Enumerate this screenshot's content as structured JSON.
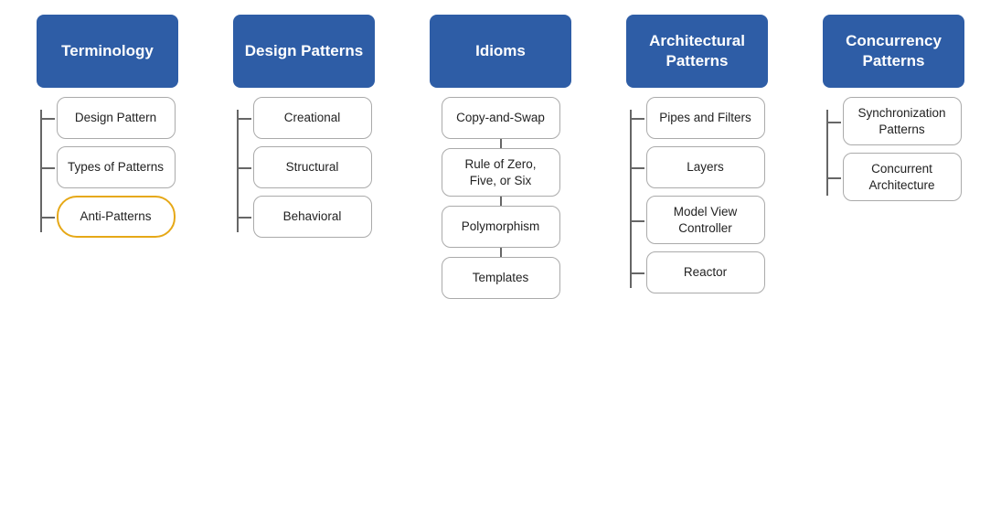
{
  "columns": [
    {
      "id": "terminology",
      "header": "Terminology",
      "treeType": "left",
      "items": [
        {
          "label": "Design Pattern",
          "highlighted": false
        },
        {
          "label": "Types of Patterns",
          "highlighted": false
        },
        {
          "label": "Anti-Patterns",
          "highlighted": true
        }
      ]
    },
    {
      "id": "design-patterns",
      "header": "Design Patterns",
      "treeType": "left",
      "items": [
        {
          "label": "Creational",
          "highlighted": false
        },
        {
          "label": "Structural",
          "highlighted": false
        },
        {
          "label": "Behavioral",
          "highlighted": false
        }
      ]
    },
    {
      "id": "idioms",
      "header": "Idioms",
      "treeType": "center",
      "items": [
        {
          "label": "Copy-and-Swap",
          "highlighted": false
        },
        {
          "label": "Rule of Zero, Five, or Six",
          "highlighted": false
        },
        {
          "label": "Polymorphism",
          "highlighted": false
        },
        {
          "label": "Templates",
          "highlighted": false
        }
      ]
    },
    {
      "id": "architectural-patterns",
      "header": "Architectural Patterns",
      "treeType": "left",
      "items": [
        {
          "label": "Pipes and Filters",
          "highlighted": false
        },
        {
          "label": "Layers",
          "highlighted": false
        },
        {
          "label": "Model View Controller",
          "highlighted": false
        },
        {
          "label": "Reactor",
          "highlighted": false
        }
      ]
    },
    {
      "id": "concurrency-patterns",
      "header": "Concurrency Patterns",
      "treeType": "left",
      "items": [
        {
          "label": "Synchronization Patterns",
          "highlighted": false
        },
        {
          "label": "Concurrent Architecture",
          "highlighted": false
        }
      ]
    }
  ]
}
